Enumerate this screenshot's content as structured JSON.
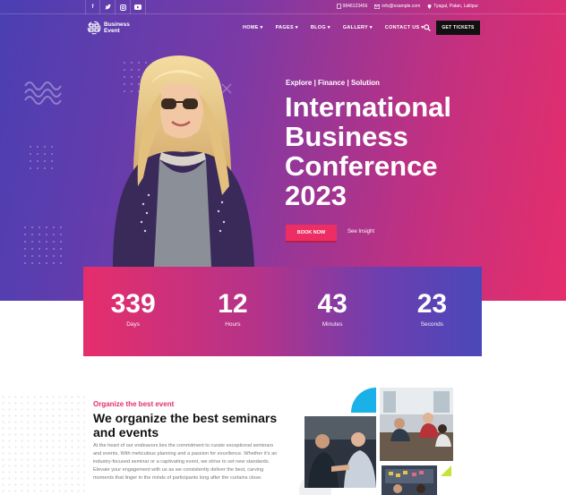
{
  "topbar": {
    "social": [
      "f",
      "t",
      "ig",
      "yt"
    ],
    "phone": "9846123456",
    "email": "info@example.com",
    "location": "Tyagal, Patan, Lalitpur"
  },
  "header": {
    "logo_line1": "Business",
    "logo_line2": "Event",
    "menu": [
      "HOME ▾",
      "PAGES ▾",
      "BLOG ▾",
      "GALLERY ▾",
      "CONTACT US ▾"
    ],
    "cta": "GET TICKETS"
  },
  "hero": {
    "kicker": "Explore | Finance | Solution",
    "title_lines": [
      "International",
      "Business",
      "Conference",
      "2023"
    ],
    "book_button": "BOOK NOW",
    "insight_link": "See Insight"
  },
  "countdown": [
    {
      "value": "339",
      "label": "Days"
    },
    {
      "value": "12",
      "label": "Hours"
    },
    {
      "value": "43",
      "label": "Minutes"
    },
    {
      "value": "23",
      "label": "Seconds"
    }
  ],
  "about": {
    "kicker": "Organize the best event",
    "title": "We organize the best seminars and events",
    "body": "At the heart of our endeavors lies the commitment to curate exceptional seminars and events. With meticulous planning and a passion for excellence. Whether it's an industry-focused seminar or a captivating event, we strive to set new standards. Elevate your engagement with us as we consistently deliver the best, carving moments that linger in the minds of participants long after the curtains close."
  },
  "colors": {
    "accent": "#e52e6c",
    "indigo": "#4a3fb3",
    "dark_button": "#111111",
    "cyan_accent": "#1ab0e8",
    "lime_accent": "#c6e23a"
  }
}
